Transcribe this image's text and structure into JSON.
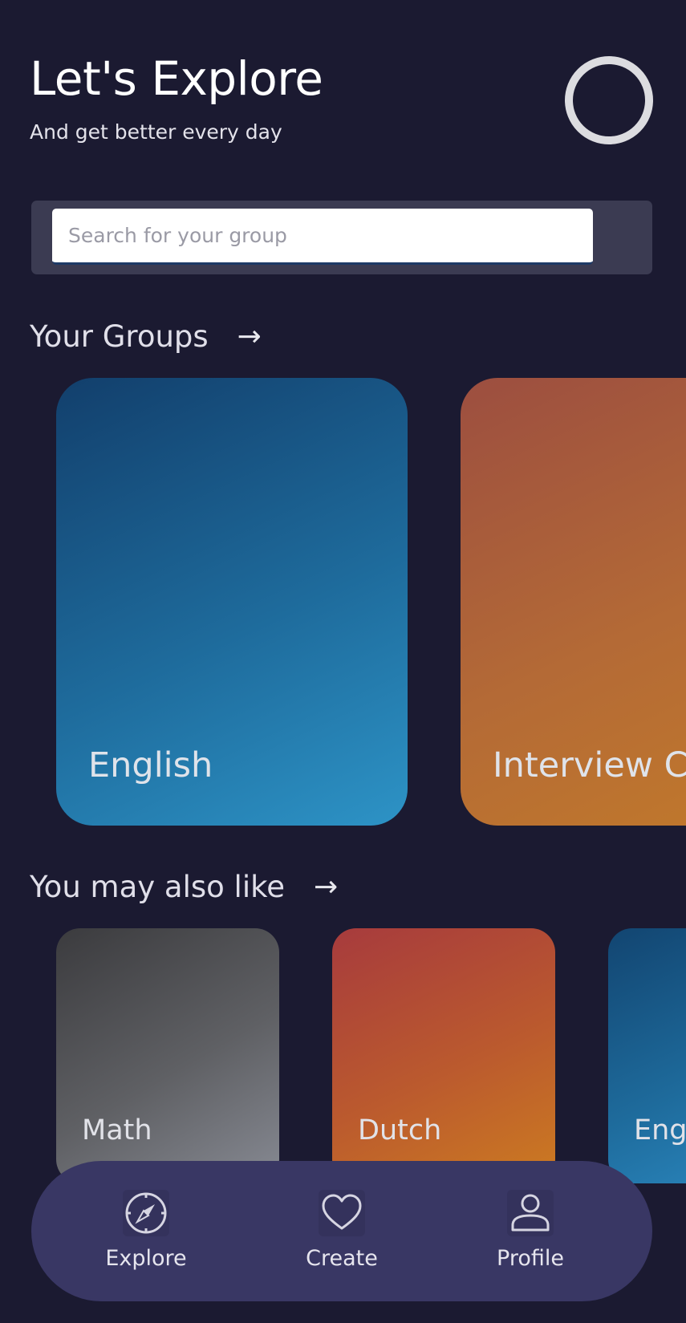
{
  "header": {
    "title": "Let's Explore",
    "subtitle": "And get better every day"
  },
  "search": {
    "placeholder": "Search for your group",
    "value": ""
  },
  "your_groups": {
    "title": "Your Groups",
    "arrow": "→",
    "cards": [
      {
        "label": "English",
        "gradient": [
          "#123f6c",
          "#2d93c6"
        ]
      },
      {
        "label": "Interview C++",
        "gradient": [
          "#9c4e40",
          "#c27a2a"
        ]
      }
    ]
  },
  "you_may_also_like": {
    "title": "You may also like",
    "arrow": "→",
    "cards": [
      {
        "label": "Math",
        "gradient": [
          "#3b3b3e",
          "#878a93"
        ]
      },
      {
        "label": "Dutch",
        "gradient": [
          "#a73b3d",
          "#cc7b21"
        ]
      },
      {
        "label": "English",
        "gradient": [
          "#124571",
          "#2d8cc4"
        ]
      }
    ]
  },
  "bottom_nav": {
    "items": [
      {
        "label": "Explore",
        "icon": "compass-icon"
      },
      {
        "label": "Create",
        "icon": "heart-icon"
      },
      {
        "label": "Profile",
        "icon": "user-icon"
      }
    ]
  },
  "colors": {
    "background": "#1b1a31",
    "search_bar_bg": "#3b3b52",
    "bottom_nav_bg": "#393764"
  }
}
